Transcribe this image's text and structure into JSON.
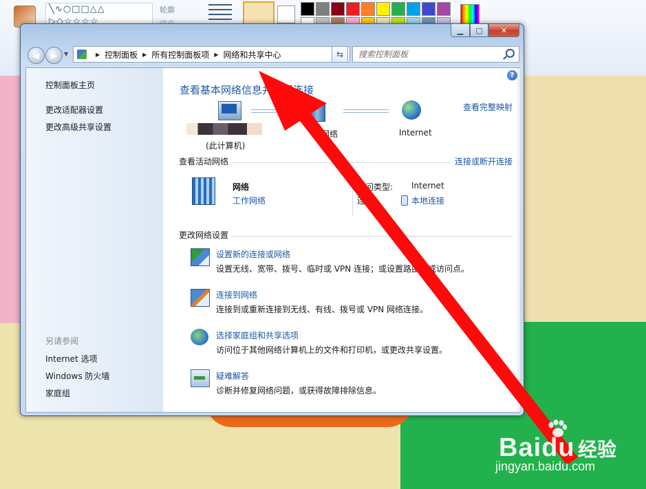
{
  "paint": {
    "outline_label": "轮廓",
    "fill_label": "填充",
    "palette_colors": [
      "#000000",
      "#7f7f7f",
      "#880015",
      "#ed1c24",
      "#ff7f27",
      "#fff200",
      "#22b14c",
      "#00a2e8",
      "#3f48cc",
      "#a349a4",
      "#ffffff",
      "#c3c3c3",
      "#b97a57",
      "#ffaec9",
      "#ffc90e",
      "#efe4b0",
      "#b5e61d",
      "#99d9ea",
      "#7092be",
      "#c8bfe7"
    ]
  },
  "window": {
    "caption": {
      "minimize": "▁",
      "maximize": "▢",
      "close": "✕"
    },
    "address": {
      "breadcrumbs": [
        "控制面板",
        "所有控制面板项",
        "网络和共享中心"
      ]
    },
    "search": {
      "placeholder": "搜索控制面板"
    }
  },
  "sidebar": {
    "items": [
      {
        "label": "控制面板主页"
      },
      {
        "label": "更改适配器设置"
      },
      {
        "label": "更改高级共享设置"
      }
    ],
    "see_also_title": "另请参阅",
    "see_also": [
      {
        "label": "Internet 选项"
      },
      {
        "label": "Windows 防火墙"
      },
      {
        "label": "家庭组"
      }
    ]
  },
  "main": {
    "title": "查看基本网络信息并设置连接",
    "view_full_map": "查看完整映射",
    "map": {
      "this_computer": "(此计算机)",
      "network_label": "网络",
      "internet_label": "Internet"
    },
    "active_networks": {
      "title": "查看活动网络",
      "connect_disconnect": "连接或断开连接",
      "network_name": "网络",
      "network_type": "工作网络",
      "access_type_label": "访问类型:",
      "access_type_value": "Internet",
      "connections_label": "连接:",
      "connections_value": "本地连接"
    },
    "change_settings": {
      "title": "更改网络设置",
      "tasks": [
        {
          "link": "设置新的连接或网络",
          "desc": "设置无线、宽带、拨号、临时或 VPN 连接；或设置路由器或访问点。"
        },
        {
          "link": "连接到网络",
          "desc": "连接到或重新连接到无线、有线、拨号或 VPN 网络连接。"
        },
        {
          "link": "选择家庭组和共享选项",
          "desc": "访问位于其他网络计算机上的文件和打印机，或更改共享设置。"
        },
        {
          "link": "疑难解答",
          "desc": "诊断并修复网络问题，或获得故障排除信息。"
        }
      ]
    }
  },
  "watermark": {
    "brand": "Bai",
    "brand2": "du",
    "cn": "经验",
    "url": "jingyan.baidu.com"
  },
  "arrow_color": "#ff0a0a"
}
